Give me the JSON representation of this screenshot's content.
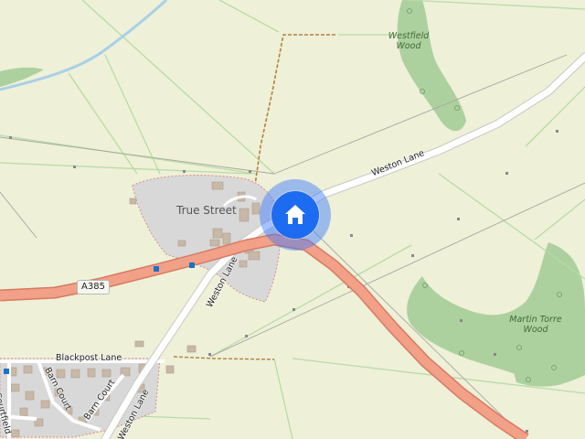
{
  "map": {
    "labels": {
      "true_street": "True Street",
      "westfield_wood": "Westfield Wood",
      "martin_torre_wood": "Martin Torre Wood",
      "weston_lane_ne": "Weston Lane",
      "weston_lane_sw": "Weston Lane",
      "weston_lane_s": "Weston Lane",
      "blackpost_lane": "Blackpost Lane",
      "barn_court_1": "Barn Court",
      "barn_court_2": "Barn Court",
      "courtfield": "Courtfield",
      "a385": "A385"
    },
    "marker": {
      "icon": "home-icon",
      "color": "#1d6bf0"
    },
    "colors": {
      "land": "#eef0d8",
      "woodland": "#add19e",
      "settlement": "#d9d9d9",
      "major_road": "#f2a088",
      "major_road_casing": "#d77a63",
      "minor_road": "#ffffff",
      "river": "#a8d0e8",
      "path": "#b5803a"
    }
  }
}
